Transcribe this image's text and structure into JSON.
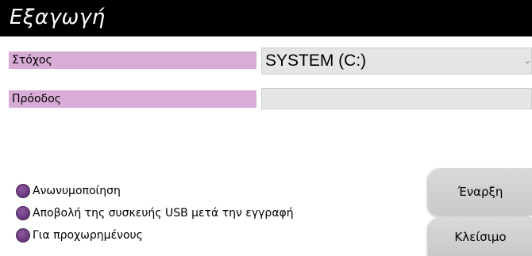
{
  "dialog": {
    "title": "Εξαγωγή"
  },
  "target": {
    "label": "Στόχος",
    "selected_value": "SYSTEM (C:)",
    "dropdown_icon": "chevron-down-icon"
  },
  "progress": {
    "label": "Πρόοδος",
    "value_percent": 0
  },
  "options": [
    {
      "label": "Ανωνυμοποίηση",
      "checked": false
    },
    {
      "label": "Αποβολή της συσκευής USB μετά την εγγραφή",
      "checked": false
    },
    {
      "label": "Για προχωρημένους",
      "checked": false
    }
  ],
  "buttons": {
    "start_label": "Έναρξη",
    "close_label": "Κλείσιμο"
  },
  "colors": {
    "title_bar": "#000000",
    "label_background": "#d8acd6",
    "radio_accent": "#6a3a7e",
    "button_background": "#d0d0d0"
  }
}
